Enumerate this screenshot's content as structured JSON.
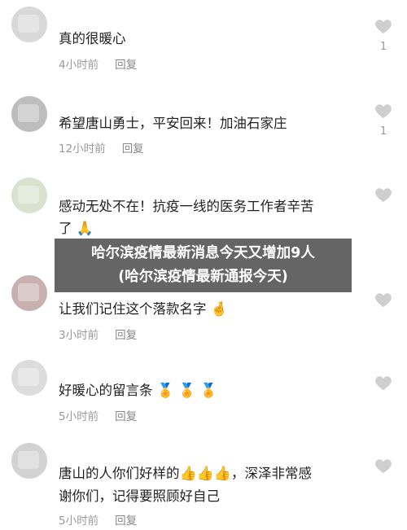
{
  "comments": [
    {
      "text": "真的很暖心",
      "time": "4小时前",
      "reply": "回复",
      "likes": "1",
      "liked_count_shown": true
    },
    {
      "text": "希望唐山勇士，平安回来！加油石家庄",
      "time": "12小时前",
      "reply": "回复",
      "likes": "1",
      "liked_count_shown": true
    },
    {
      "text_line1": "感动无处不在！抗疫一线的医务工作者辛苦",
      "text_line2": "了",
      "emoji": "🙏"
    },
    {
      "text": "让我们记住这个落款名字",
      "emoji": "🤞",
      "time": "3小时前",
      "reply": "回复"
    },
    {
      "text": "好暖心的留言条",
      "emoji": "🏅 🏅 🏅",
      "time": "5小时前",
      "reply": "回复"
    },
    {
      "text_line1": "唐山的人你们好样的",
      "emoji": "👍👍👍",
      "text_line1_end": "，深泽非常感",
      "text_line2": "谢你们，记得要照顾好自己",
      "time": "5小时前",
      "reply": "回复"
    }
  ],
  "banner": {
    "line1": "哈尔滨疫情最新消息今天又增加9人",
    "line2": "(哈尔滨疫情最新通报今天)"
  },
  "colors": {
    "heart": "#cfcfcf",
    "meta": "#999999",
    "text": "#222222",
    "banner_bg": "#505050"
  }
}
